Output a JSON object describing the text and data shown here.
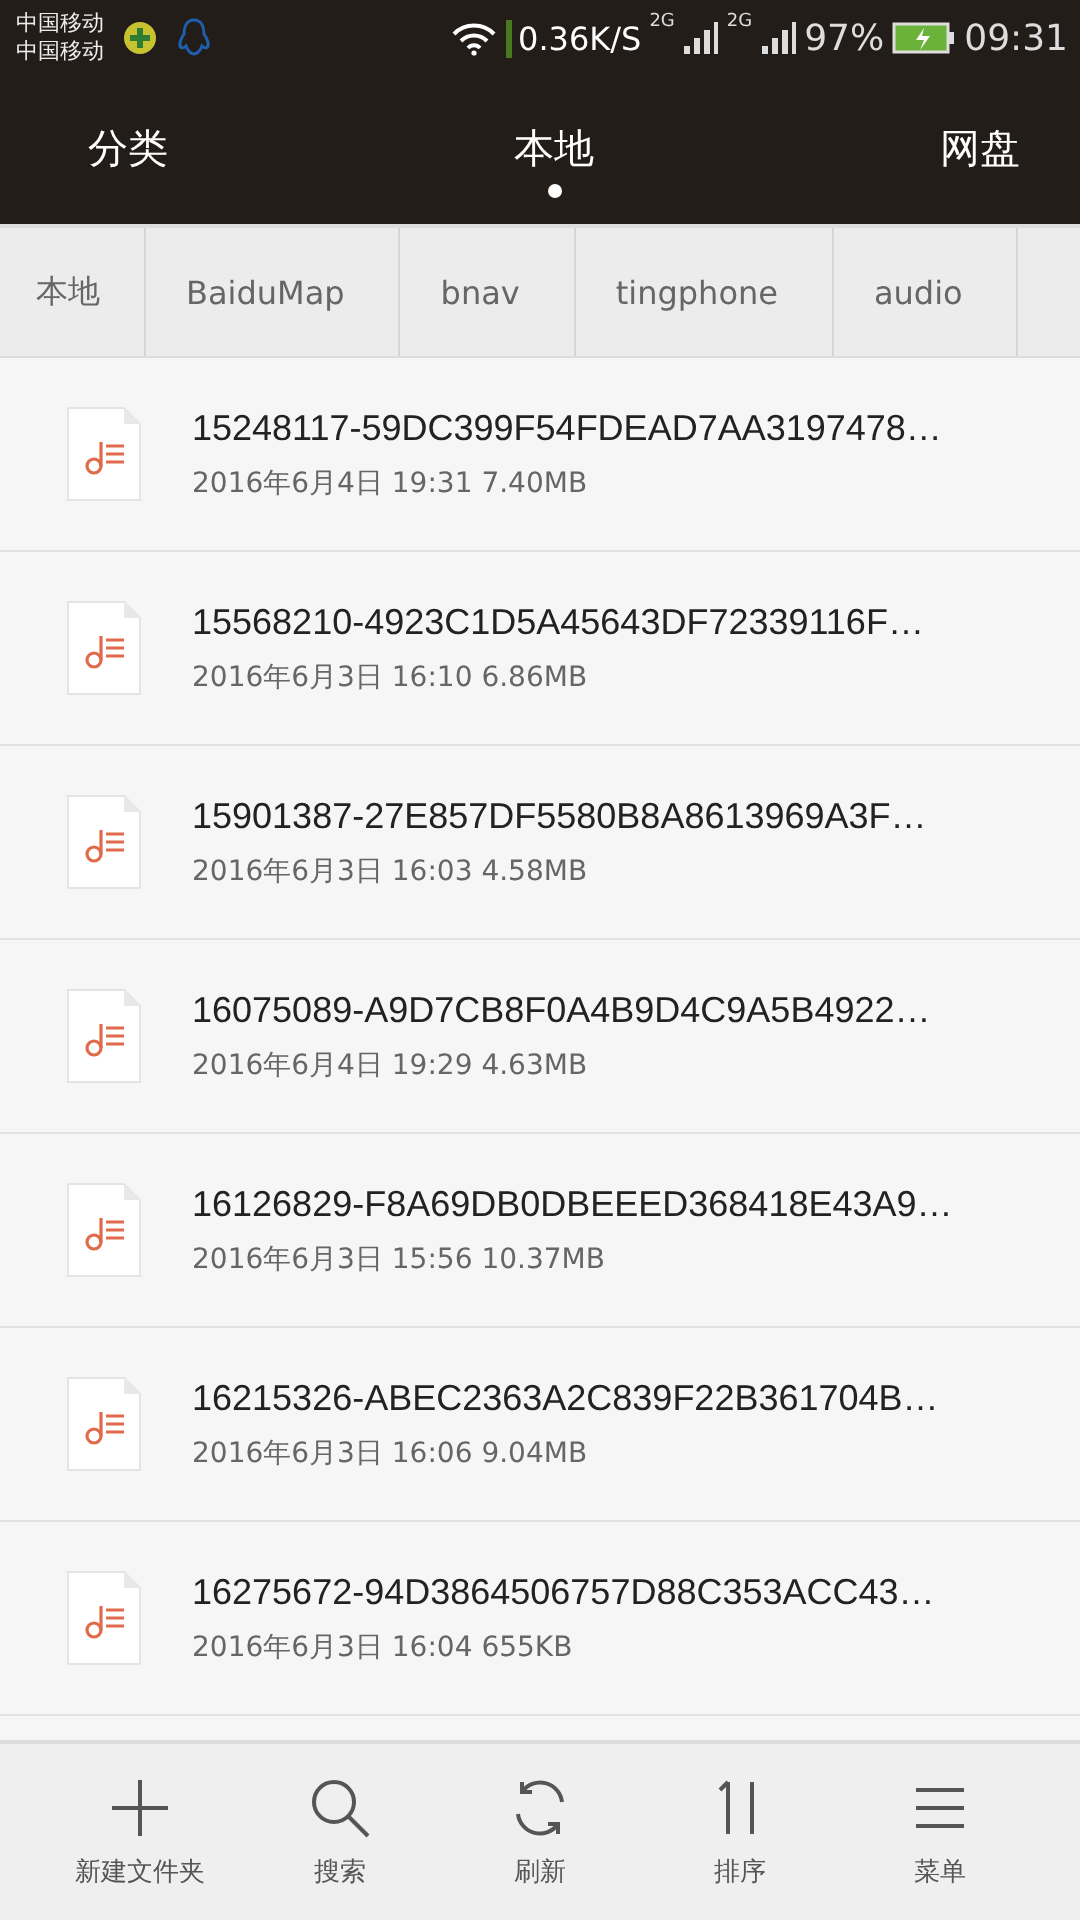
{
  "status_bar": {
    "carriers": [
      "中国移动",
      "中国移动"
    ],
    "speed": "0.36K/S",
    "networks": [
      "2G",
      "2G"
    ],
    "battery": "97%",
    "time": "09:31"
  },
  "tabs": [
    {
      "label": "分类",
      "selected": false
    },
    {
      "label": "本地",
      "selected": true
    },
    {
      "label": "网盘",
      "selected": false
    }
  ],
  "breadcrumb": [
    "本地",
    "BaiduMap",
    "bnav",
    "tingphone",
    "audio"
  ],
  "files": [
    {
      "name": "15248117-59DC399F54FDEAD7AA3197478…",
      "details": "2016年6月4日 19:31 7.40MB"
    },
    {
      "name": "15568210-4923C1D5A45643DF72339116F…",
      "details": "2016年6月3日 16:10 6.86MB"
    },
    {
      "name": "15901387-27E857DF5580B8A8613969A3F…",
      "details": "2016年6月3日 16:03 4.58MB"
    },
    {
      "name": "16075089-A9D7CB8F0A4B9D4C9A5B4922…",
      "details": "2016年6月4日 19:29 4.63MB"
    },
    {
      "name": "16126829-F8A69DB0DBEEED368418E43A9…",
      "details": "2016年6月3日 15:56 10.37MB"
    },
    {
      "name": "16215326-ABEC2363A2C839F22B361704B…",
      "details": "2016年6月3日 16:06 9.04MB"
    },
    {
      "name": "16275672-94D3864506757D88C353ACC43…",
      "details": "2016年6月3日 16:04 655KB"
    }
  ],
  "toolbar": [
    {
      "kind": "plus",
      "label": "新建文件夹"
    },
    {
      "kind": "search",
      "label": "搜索"
    },
    {
      "kind": "refresh",
      "label": "刷新"
    },
    {
      "kind": "sort",
      "label": "排序"
    },
    {
      "kind": "menu",
      "label": "菜单"
    }
  ]
}
